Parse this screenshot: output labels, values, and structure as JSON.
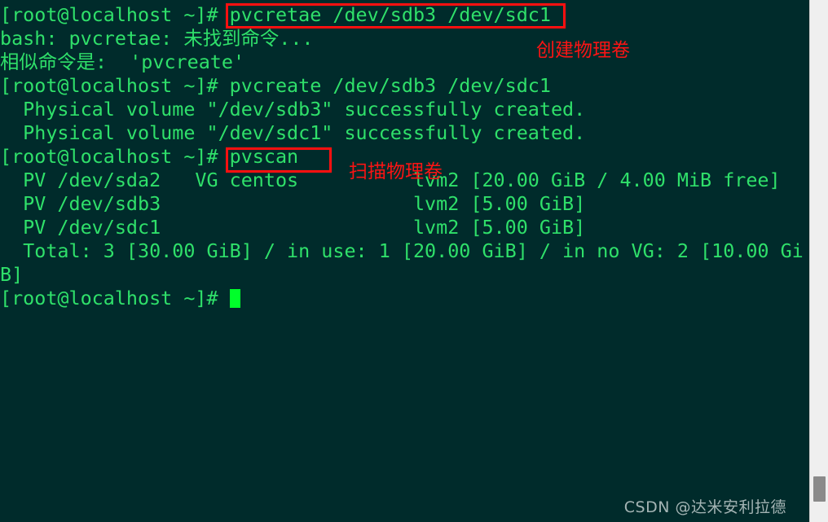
{
  "terminal": {
    "background_color": "#002b2b",
    "text_color": "#2fe06a",
    "cursor_color": "#00ff2a",
    "annotation_color": "#fb1414",
    "prompt": "[root@localhost ~]# ",
    "lines": [
      {
        "id": "line-1",
        "text": "[root@localhost ~]# pvcretae /dev/sdb3 /dev/sdc1"
      },
      {
        "id": "line-2",
        "text": "bash: pvcretae: 未找到命令..."
      },
      {
        "id": "line-3",
        "text": "相似命令是:  'pvcreate'"
      },
      {
        "id": "line-4",
        "text": "[root@localhost ~]# pvcreate /dev/sdb3 /dev/sdc1"
      },
      {
        "id": "line-5",
        "text": "  Physical volume \"/dev/sdb3\" successfully created."
      },
      {
        "id": "line-6",
        "text": "  Physical volume \"/dev/sdc1\" successfully created."
      },
      {
        "id": "line-7",
        "text": "[root@localhost ~]# pvscan"
      },
      {
        "id": "line-8",
        "text": "  PV /dev/sda2   VG centos          lvm2 [20.00 GiB / 4.00 MiB free]"
      },
      {
        "id": "line-9",
        "text": "  PV /dev/sdb3                      lvm2 [5.00 GiB]"
      },
      {
        "id": "line-10",
        "text": "  PV /dev/sdc1                      lvm2 [5.00 GiB]"
      },
      {
        "id": "line-11",
        "text": "  Total: 3 [30.00 GiB] / in use: 1 [20.00 GiB] / in no VG: 2 [10.00 Gi"
      },
      {
        "id": "line-12",
        "text": "B]"
      },
      {
        "id": "line-13",
        "text": "[root@localhost ~]# "
      }
    ]
  },
  "annotations": {
    "note_create_pv": "创建物理卷",
    "note_scan_pv": "扫描物理卷",
    "boxes": [
      {
        "id": "box-pvcretae-command",
        "label": "pvcretae /dev/sdb3 /dev/sdc1"
      },
      {
        "id": "box-pvscan-command",
        "label": "pvscan"
      }
    ]
  },
  "watermark": {
    "text": "CSDN @达米安利拉德"
  },
  "scrollbar": {
    "orientation": "vertical",
    "thumb_position": "bottom"
  }
}
